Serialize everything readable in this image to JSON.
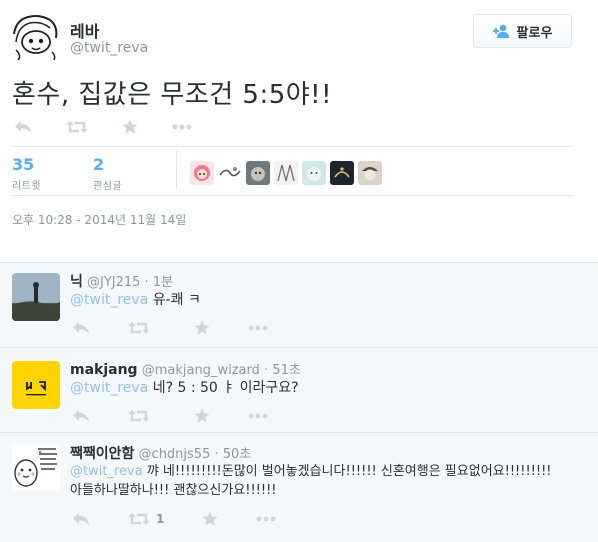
{
  "tweet": {
    "user_name": "레바",
    "user_handle": "@twit_reva",
    "text": "혼수, 집값은 무조건 5:5야!!",
    "follow_label": "팔로우",
    "retweets_count": "35",
    "retweets_label": "리트윗",
    "favorites_count": "2",
    "favorites_label": "관심글",
    "timestamp": "오후 10:28 - 2014년 11월 14일"
  },
  "replies": [
    {
      "name": "닉",
      "handle": "@JYJ215",
      "time": "1분",
      "mention": "@twit_reva",
      "text": " 유-쾌 ㅋ",
      "retweet_count": ""
    },
    {
      "name": "makjang",
      "handle": "@makjang_wizard",
      "time": "51초",
      "mention": "@twit_reva",
      "text": " 네? 5 : 50 ㅑ 이라구요?",
      "retweet_count": ""
    },
    {
      "name": "짹짹이안함",
      "handle": "@chdnjs55",
      "time": "50초",
      "mention": "@twit_reva",
      "text": " 꺄 네!!!!!!!!!돈많이 벌어놓겠습니다!!!!!! 신혼여행은 필요없어요!!!!!!!!!",
      "text2": "아들하나딸하나!!! 괜찮으신가요!!!!!!",
      "retweet_count": "1"
    }
  ],
  "colors": {
    "accent": "#55acee",
    "mention": "#8ec3f0",
    "muted": "#8899a6",
    "icon": "#ccd6dd",
    "reply_bg": "#f5f8fa"
  },
  "icons": [
    "reply-icon",
    "retweet-icon",
    "favorite-icon",
    "more-icon",
    "follow-person-icon"
  ]
}
